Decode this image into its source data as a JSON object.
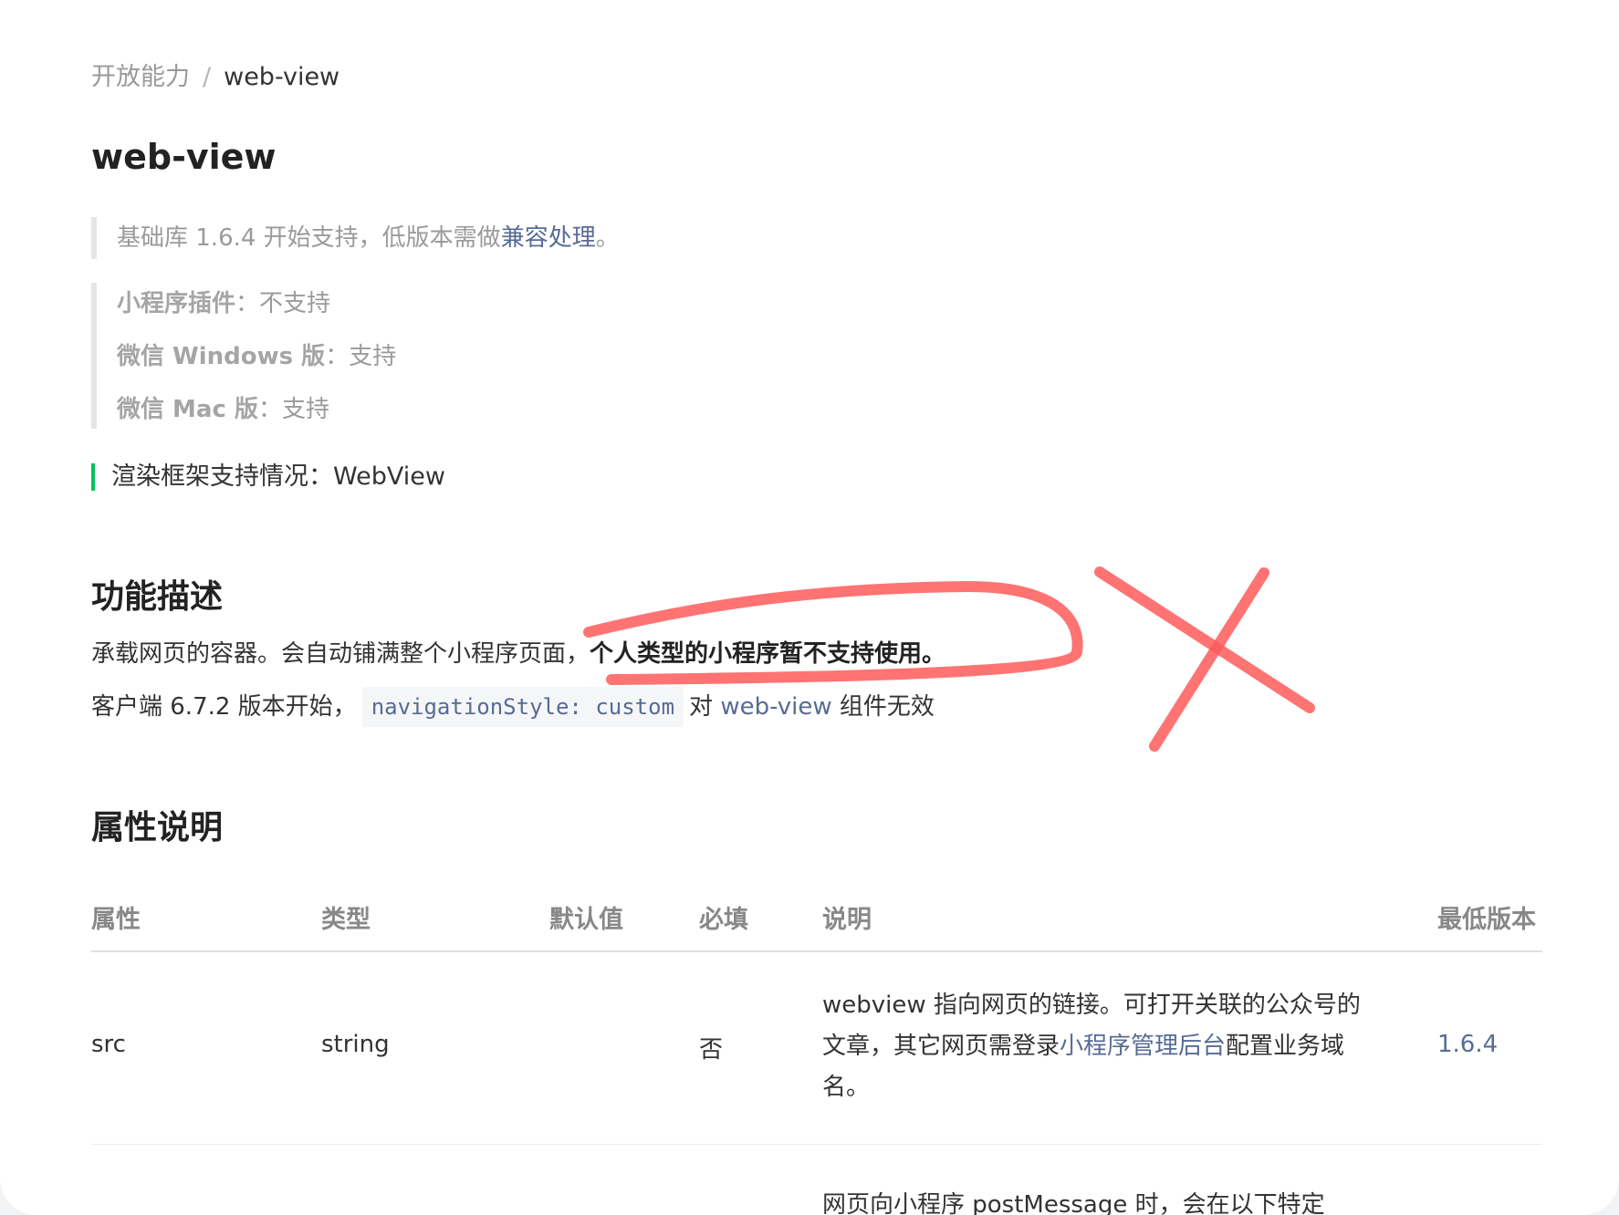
{
  "breadcrumb": {
    "parent": "开放能力",
    "separator": "/",
    "current": "web-view"
  },
  "title": "web-view",
  "compat_note": {
    "text": "基础库 1.6.4 开始支持，低版本需做",
    "link": "兼容处理",
    "suffix": "。"
  },
  "support": [
    {
      "label": "小程序插件",
      "colon": "：",
      "value": "不支持"
    },
    {
      "label": "微信 Windows 版",
      "colon": "：",
      "value": "支持"
    },
    {
      "label": "微信 Mac 版",
      "colon": "：",
      "value": "支持"
    }
  ],
  "render_frame": "渲染框架支持情况：WebView",
  "section_function": {
    "heading": "功能描述",
    "line1_plain": "承载网页的容器。会自动铺满整个小程序页面，",
    "line1_bold": "个人类型的小程序暂不支持使用。",
    "line2_prefix": "客户端 6.7.2 版本开始，",
    "line2_code": "navigationStyle: custom",
    "line2_mid": "对",
    "line2_link": "web-view",
    "line2_suffix": "组件无效"
  },
  "section_attrs": {
    "heading": "属性说明",
    "columns": [
      "属性",
      "类型",
      "默认值",
      "必填",
      "说明",
      "最低版本"
    ],
    "rows": [
      {
        "attr": "src",
        "type": "string",
        "default": "",
        "required": "否",
        "desc_prefix": "webview 指向网页的链接。可打开关联的公众号的文章，其它网页需登录",
        "desc_link": "小程序管理后台",
        "desc_suffix": "配置业务域名。",
        "version": "1.6.4"
      }
    ],
    "next_row_desc": "网页向小程序 postMessage 时，会在以下特定"
  },
  "colors": {
    "link": "#576b95",
    "accent_green": "#07c160",
    "annotation_red": "#ff5a5a"
  }
}
